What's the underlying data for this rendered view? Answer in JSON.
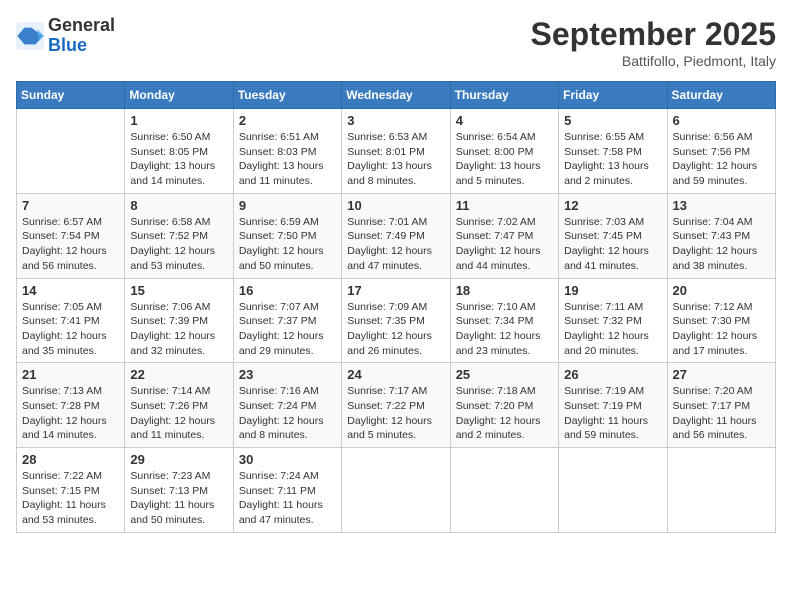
{
  "logo": {
    "general": "General",
    "blue": "Blue"
  },
  "title": "September 2025",
  "subtitle": "Battifollo, Piedmont, Italy",
  "days_of_week": [
    "Sunday",
    "Monday",
    "Tuesday",
    "Wednesday",
    "Thursday",
    "Friday",
    "Saturday"
  ],
  "weeks": [
    [
      {
        "day": "",
        "info": ""
      },
      {
        "day": "1",
        "info": "Sunrise: 6:50 AM\nSunset: 8:05 PM\nDaylight: 13 hours\nand 14 minutes."
      },
      {
        "day": "2",
        "info": "Sunrise: 6:51 AM\nSunset: 8:03 PM\nDaylight: 13 hours\nand 11 minutes."
      },
      {
        "day": "3",
        "info": "Sunrise: 6:53 AM\nSunset: 8:01 PM\nDaylight: 13 hours\nand 8 minutes."
      },
      {
        "day": "4",
        "info": "Sunrise: 6:54 AM\nSunset: 8:00 PM\nDaylight: 13 hours\nand 5 minutes."
      },
      {
        "day": "5",
        "info": "Sunrise: 6:55 AM\nSunset: 7:58 PM\nDaylight: 13 hours\nand 2 minutes."
      },
      {
        "day": "6",
        "info": "Sunrise: 6:56 AM\nSunset: 7:56 PM\nDaylight: 12 hours\nand 59 minutes."
      }
    ],
    [
      {
        "day": "7",
        "info": "Sunrise: 6:57 AM\nSunset: 7:54 PM\nDaylight: 12 hours\nand 56 minutes."
      },
      {
        "day": "8",
        "info": "Sunrise: 6:58 AM\nSunset: 7:52 PM\nDaylight: 12 hours\nand 53 minutes."
      },
      {
        "day": "9",
        "info": "Sunrise: 6:59 AM\nSunset: 7:50 PM\nDaylight: 12 hours\nand 50 minutes."
      },
      {
        "day": "10",
        "info": "Sunrise: 7:01 AM\nSunset: 7:49 PM\nDaylight: 12 hours\nand 47 minutes."
      },
      {
        "day": "11",
        "info": "Sunrise: 7:02 AM\nSunset: 7:47 PM\nDaylight: 12 hours\nand 44 minutes."
      },
      {
        "day": "12",
        "info": "Sunrise: 7:03 AM\nSunset: 7:45 PM\nDaylight: 12 hours\nand 41 minutes."
      },
      {
        "day": "13",
        "info": "Sunrise: 7:04 AM\nSunset: 7:43 PM\nDaylight: 12 hours\nand 38 minutes."
      }
    ],
    [
      {
        "day": "14",
        "info": "Sunrise: 7:05 AM\nSunset: 7:41 PM\nDaylight: 12 hours\nand 35 minutes."
      },
      {
        "day": "15",
        "info": "Sunrise: 7:06 AM\nSunset: 7:39 PM\nDaylight: 12 hours\nand 32 minutes."
      },
      {
        "day": "16",
        "info": "Sunrise: 7:07 AM\nSunset: 7:37 PM\nDaylight: 12 hours\nand 29 minutes."
      },
      {
        "day": "17",
        "info": "Sunrise: 7:09 AM\nSunset: 7:35 PM\nDaylight: 12 hours\nand 26 minutes."
      },
      {
        "day": "18",
        "info": "Sunrise: 7:10 AM\nSunset: 7:34 PM\nDaylight: 12 hours\nand 23 minutes."
      },
      {
        "day": "19",
        "info": "Sunrise: 7:11 AM\nSunset: 7:32 PM\nDaylight: 12 hours\nand 20 minutes."
      },
      {
        "day": "20",
        "info": "Sunrise: 7:12 AM\nSunset: 7:30 PM\nDaylight: 12 hours\nand 17 minutes."
      }
    ],
    [
      {
        "day": "21",
        "info": "Sunrise: 7:13 AM\nSunset: 7:28 PM\nDaylight: 12 hours\nand 14 minutes."
      },
      {
        "day": "22",
        "info": "Sunrise: 7:14 AM\nSunset: 7:26 PM\nDaylight: 12 hours\nand 11 minutes."
      },
      {
        "day": "23",
        "info": "Sunrise: 7:16 AM\nSunset: 7:24 PM\nDaylight: 12 hours\nand 8 minutes."
      },
      {
        "day": "24",
        "info": "Sunrise: 7:17 AM\nSunset: 7:22 PM\nDaylight: 12 hours\nand 5 minutes."
      },
      {
        "day": "25",
        "info": "Sunrise: 7:18 AM\nSunset: 7:20 PM\nDaylight: 12 hours\nand 2 minutes."
      },
      {
        "day": "26",
        "info": "Sunrise: 7:19 AM\nSunset: 7:19 PM\nDaylight: 11 hours\nand 59 minutes."
      },
      {
        "day": "27",
        "info": "Sunrise: 7:20 AM\nSunset: 7:17 PM\nDaylight: 11 hours\nand 56 minutes."
      }
    ],
    [
      {
        "day": "28",
        "info": "Sunrise: 7:22 AM\nSunset: 7:15 PM\nDaylight: 11 hours\nand 53 minutes."
      },
      {
        "day": "29",
        "info": "Sunrise: 7:23 AM\nSunset: 7:13 PM\nDaylight: 11 hours\nand 50 minutes."
      },
      {
        "day": "30",
        "info": "Sunrise: 7:24 AM\nSunset: 7:11 PM\nDaylight: 11 hours\nand 47 minutes."
      },
      {
        "day": "",
        "info": ""
      },
      {
        "day": "",
        "info": ""
      },
      {
        "day": "",
        "info": ""
      },
      {
        "day": "",
        "info": ""
      }
    ]
  ]
}
